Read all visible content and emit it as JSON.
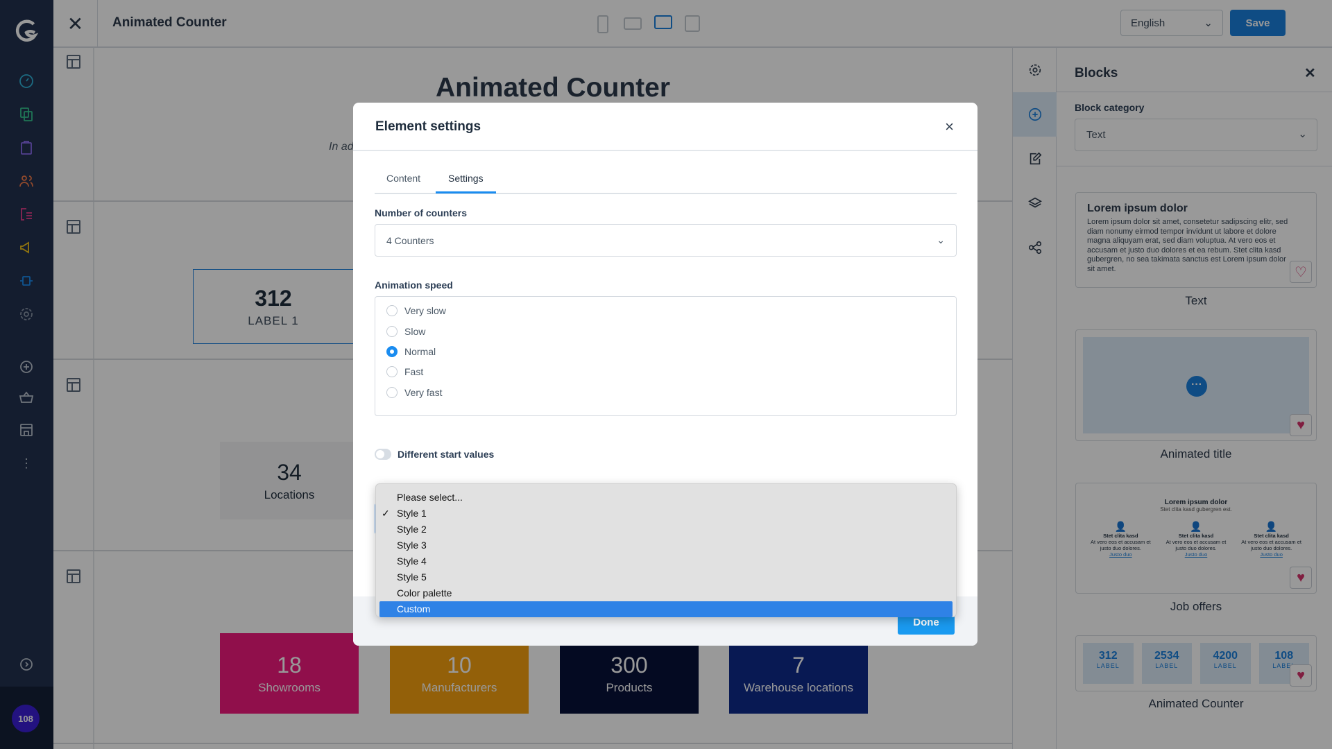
{
  "app": {
    "title": "Animated Counter",
    "language": "English",
    "save_label": "Save",
    "accent": "#1a7fdc"
  },
  "sidebar": {
    "icons": [
      "logo-icon",
      "dashboard-icon",
      "catalogue-icon",
      "orders-icon",
      "customers-icon",
      "content-icon",
      "marketing-icon",
      "extensions-icon",
      "settings-icon",
      "add-icon",
      "basket-icon",
      "store-icon",
      "more-icon",
      "expand-icon"
    ],
    "avatar": "108"
  },
  "devices": [
    "mobile-icon",
    "tablet-icon",
    "desktop-icon",
    "list-icon"
  ],
  "canvas": {
    "heading": "Animated Counter",
    "subtext": "In ad",
    "counter1": {
      "value": "312",
      "label": "LABEL 1"
    },
    "counter2": {
      "value": "34",
      "label": "Locations"
    },
    "tiles": [
      {
        "value": "18",
        "label": "Showrooms",
        "color": "#f0197d"
      },
      {
        "value": "10",
        "label": "Manufacturers",
        "color": "#f5a010"
      },
      {
        "value": "300",
        "label": "Products",
        "color": "#08113a"
      },
      {
        "value": "7",
        "label": "Warehouse locations",
        "color": "#0e2a8a"
      }
    ]
  },
  "modal": {
    "title": "Element settings",
    "tabs": [
      {
        "label": "Content"
      },
      {
        "label": "Settings",
        "active": true
      }
    ],
    "counters_label": "Number of counters",
    "counters_value": "4 Counters",
    "speed_label": "Animation speed",
    "speeds": [
      "Very slow",
      "Slow",
      "Normal",
      "Fast",
      "Very fast"
    ],
    "speed_selected": "Normal",
    "toggle_label": "Different start values",
    "toggle_on": false,
    "done_label": "Done",
    "style_options": [
      "Please select...",
      "Style 1",
      "Style 2",
      "Style 3",
      "Style 4",
      "Style 5",
      "Color palette",
      "Custom"
    ],
    "style_checked": "Style 1",
    "style_highlighted": "Custom",
    "check_mark": "✓"
  },
  "blocks": {
    "title": "Blocks",
    "category_label": "Block category",
    "category_value": "Text",
    "text_card": {
      "heading": "Lorem ipsum dolor",
      "body": "Lorem ipsum dolor sit amet, consetetur sadipscing elitr, sed diam nonumy eirmod tempor invidunt ut labore et dolore magna aliquyam erat, sed diam voluptua. At vero eos et accusam et justo duo dolores et ea rebum. Stet clita kasd gubergren, no sea takimata sanctus est Lorem ipsum dolor sit amet.",
      "caption": "Text"
    },
    "title_card": {
      "caption": "Animated title"
    },
    "jobs_card": {
      "heading": "Lorem ipsum dolor",
      "sub": "Stet clita kasd gubergren est.",
      "cols": [
        {
          "title": "Stet clita kasd",
          "text": "At vero eos et accusam et justo duo dolores.",
          "link": "Justo duo"
        },
        {
          "title": "Stet clita kasd",
          "text": "At vero eos et accusam et justo duo dolores.",
          "link": "Justo duo"
        },
        {
          "title": "Stet clita kasd",
          "text": "At vero eos et accusam et justo duo dolores.",
          "link": "Justo duo"
        }
      ],
      "caption": "Job offers"
    },
    "counter_card": {
      "items": [
        {
          "v": "312",
          "l": "LABEL"
        },
        {
          "v": "2534",
          "l": "LABEL"
        },
        {
          "v": "4200",
          "l": "LABEL"
        },
        {
          "v": "108",
          "l": "LABEL"
        }
      ],
      "caption": "Animated Counter"
    }
  }
}
